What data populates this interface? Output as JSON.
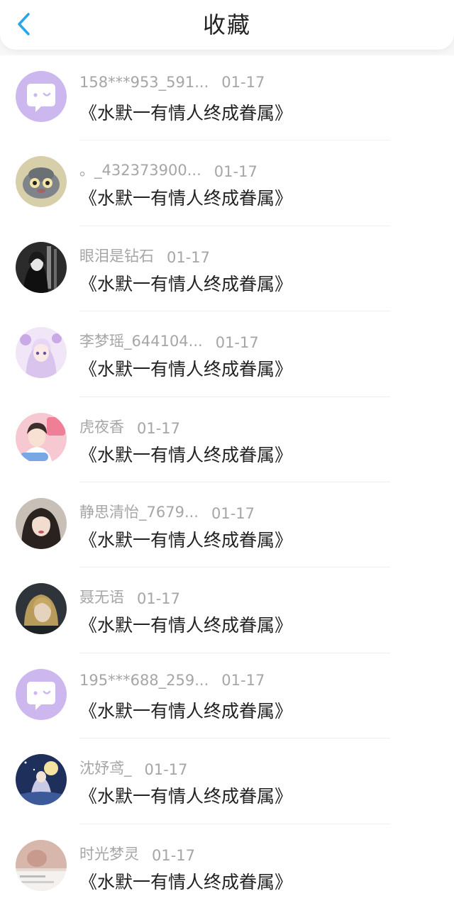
{
  "header": {
    "title": "收藏",
    "back_icon": "chevron-left-icon",
    "accent_color": "#2aa5e8"
  },
  "items": [
    {
      "name": "158***953_591...",
      "date": "01-17",
      "content": "《水默一有情人终成眷属》",
      "avatar": "default-chat-avatar"
    },
    {
      "name": "。_432373900...",
      "date": "01-17",
      "content": "《水默一有情人终成眷属》",
      "avatar": "cartoon-avatar"
    },
    {
      "name": "眼泪是钻石",
      "date": "01-17",
      "content": "《水默一有情人终成眷属》",
      "avatar": "gothic-girl-avatar"
    },
    {
      "name": "李梦瑶_644104...",
      "date": "01-17",
      "content": "《水默一有情人终成眷属》",
      "avatar": "anime-girl-avatar"
    },
    {
      "name": "虎夜香",
      "date": "01-17",
      "content": "《水默一有情人终成眷属》",
      "avatar": "idol-avatar"
    },
    {
      "name": "静思清怡_7679...",
      "date": "01-17",
      "content": "《水默一有情人终成眷属》",
      "avatar": "photo-girl-avatar"
    },
    {
      "name": "聂无语",
      "date": "01-17",
      "content": "《水默一有情人终成眷属》",
      "avatar": "blonde-girl-avatar"
    },
    {
      "name": "195***688_259...",
      "date": "01-17",
      "content": "《水默一有情人终成眷属》",
      "avatar": "default-chat-avatar"
    },
    {
      "name": "沈妤鸢_",
      "date": "01-17",
      "content": "《水默一有情人终成眷属》",
      "avatar": "night-scene-avatar"
    },
    {
      "name": "时光梦灵",
      "date": "01-17",
      "content": "《水默一有情人终成眷属》",
      "avatar": "blurred-photo-avatar"
    }
  ]
}
